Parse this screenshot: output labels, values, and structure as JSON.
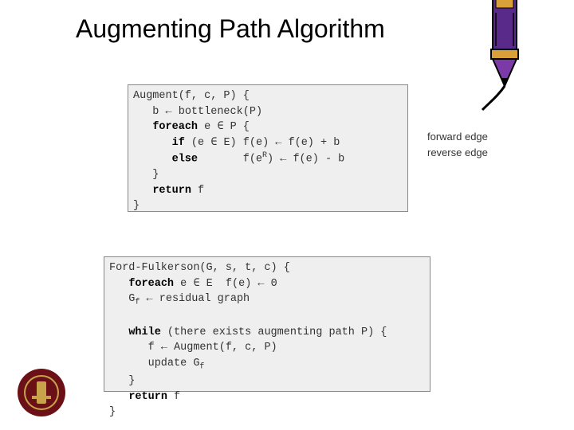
{
  "title": "Augmenting Path Algorithm",
  "augment": {
    "l1a": "Augment(f, c, P) {",
    "l2a": "   b ",
    "l2b": " bottleneck(P)",
    "l3a": "   ",
    "l3b": "foreach",
    "l3c": " e ",
    "l3d": " P {",
    "l4a": "      ",
    "l4b": "if",
    "l4c": " (e ",
    "l4d": " E) f(e) ",
    "l4e": " f(e) + b",
    "l5a": "      ",
    "l5b": "else",
    "l5c": "       f(e",
    "l5d": ") ",
    "l5e": " f(e) - b",
    "l6a": "   }",
    "l7a": "   ",
    "l7b": "return",
    "l7c": " f",
    "l8a": "}"
  },
  "ford": {
    "l1a": "Ford-Fulkerson(G, s, t, c) {",
    "l2a": "   ",
    "l2b": "foreach",
    "l2c": " e ",
    "l2d": " E  f(e) ",
    "l2e": " 0",
    "l3a": "   G",
    "l3b": " ",
    "l3c": " residual graph",
    "blank": "",
    "l4a": "   ",
    "l4b": "while",
    "l4c": " (there exists augmenting path P) {",
    "l5a": "      f ",
    "l5b": " Augment(f, c, P)",
    "l6a": "      update G",
    "l7a": "   }",
    "l8a": "   ",
    "l8b": "return",
    "l8c": " f",
    "l9a": "}"
  },
  "annot": {
    "forward": "forward edge",
    "reverse": "reverse edge"
  },
  "glyph": {
    "leftarrow": "←",
    "in": "∈",
    "supR": "R",
    "subf": "f"
  }
}
